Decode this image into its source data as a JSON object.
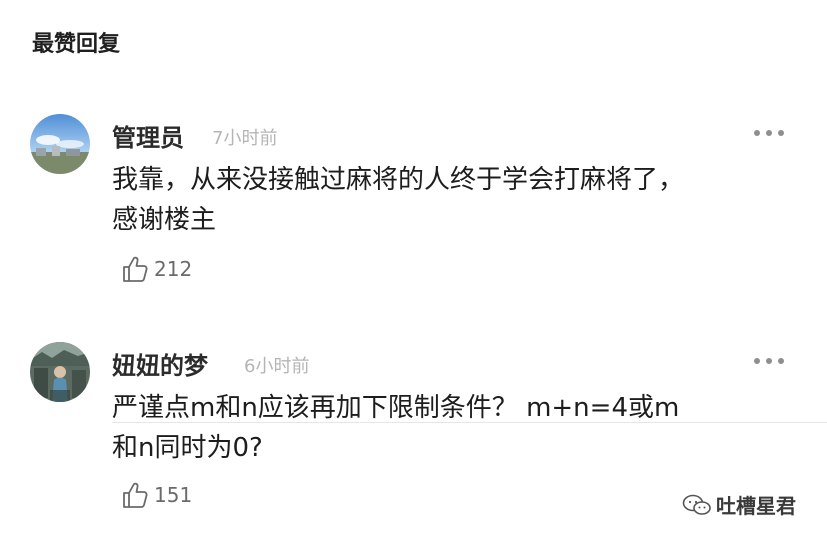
{
  "section": {
    "title": "最赞回复"
  },
  "comments": [
    {
      "name": "管理员",
      "time": "7小时前",
      "text": "我靠，从来没接触过麻将的人终于学会打麻将了，\n感谢楼主",
      "likes": "212"
    },
    {
      "name": "妞妞的梦",
      "time": "6小时前",
      "text": "严谨点m和n应该再加下限制条件？ m+n=4或m\n和n同时为0?",
      "likes": "151"
    }
  ],
  "watermark": {
    "text": "吐槽星君"
  },
  "colors": {
    "time": "#b5b5b5",
    "icon": "#8f8f8f",
    "divider": "#e6e6e6"
  },
  "icons": {
    "more": "more-dots-icon",
    "like": "thumbs-up-icon"
  }
}
